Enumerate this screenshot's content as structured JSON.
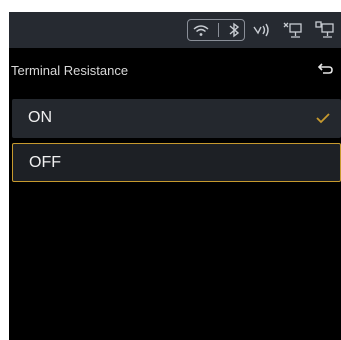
{
  "colors": {
    "accent": "#c79a2e",
    "background": "#000000",
    "status_bar": "#262a31",
    "row": "#24282e"
  },
  "status_bar": {
    "icons": [
      "wifi-icon",
      "bluetooth-icon",
      "signal-icon",
      "device-link-icon",
      "vci-connection-icon"
    ]
  },
  "header": {
    "title": "Terminal Resistance",
    "back_icon": "back-arrow-icon"
  },
  "options": [
    {
      "label": "ON",
      "selected": true
    },
    {
      "label": "OFF",
      "selected": false,
      "focused": true
    }
  ]
}
